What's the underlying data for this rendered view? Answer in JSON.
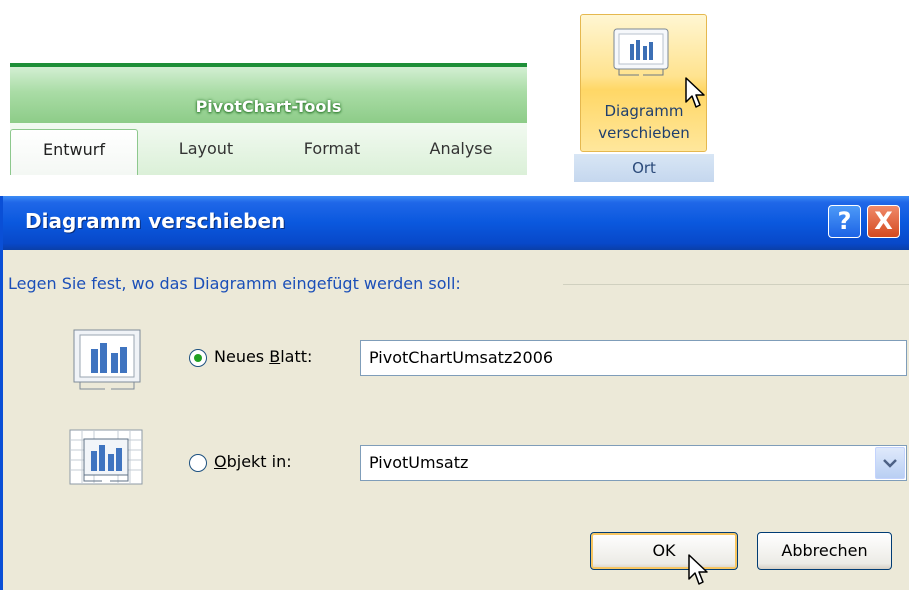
{
  "ribbon": {
    "context_title": "PivotChart-Tools",
    "tabs": [
      {
        "label": "Entwurf",
        "active": true
      },
      {
        "label": "Layout",
        "active": false
      },
      {
        "label": "Format",
        "active": false
      },
      {
        "label": "Analyse",
        "active": false
      }
    ]
  },
  "move_button": {
    "label_line1": "Diagramm",
    "label_line2": "verschieben",
    "group_label": "Ort",
    "icon": "chart-move-icon"
  },
  "dialog": {
    "title": "Diagramm verschieben",
    "help_label": "?",
    "close_label": "X",
    "prompt": "Legen Sie fest, wo das Diagramm eingefügt werden soll:",
    "option_new_sheet": {
      "label_prefix": "Neues ",
      "label_accel": "B",
      "label_suffix": "latt:",
      "checked": true,
      "value": "PivotChartUmsatz2006",
      "icon": "chart-sheet-icon"
    },
    "option_object": {
      "label_accel": "O",
      "label_suffix": "bjekt in:",
      "checked": false,
      "value": "PivotUmsatz",
      "icon": "embedded-chart-icon"
    },
    "ok_label": "OK",
    "cancel_label": "Abbrechen"
  },
  "colors": {
    "context_green": "#8dcc88",
    "xp_title_blue": "#0a58de",
    "dialog_bg": "#ece9d8",
    "radio_dot": "#21a121"
  }
}
